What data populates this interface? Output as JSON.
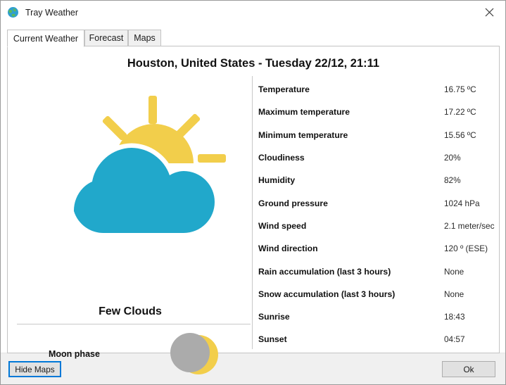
{
  "window": {
    "title": "Tray Weather",
    "app_icon": "globe-icon",
    "close_icon": "close-icon"
  },
  "tabs": [
    {
      "label": "Current Weather",
      "active": true
    },
    {
      "label": "Forecast",
      "active": false
    },
    {
      "label": "Maps",
      "active": false
    }
  ],
  "header": {
    "title": "Houston, United States - Tuesday 22/12, 21:11"
  },
  "current": {
    "icon": "few-clouds-icon",
    "condition": "Few Clouds",
    "moon_label": "Moon phase",
    "moon_icon": "waning-crescent-moon-icon"
  },
  "details": [
    {
      "label": "Temperature",
      "value": "16.75 ºC"
    },
    {
      "label": "Maximum temperature",
      "value": "17.22 ºC"
    },
    {
      "label": "Minimum temperature",
      "value": "15.56 ºC"
    },
    {
      "label": "Cloudiness",
      "value": "20%"
    },
    {
      "label": "Humidity",
      "value": "82%"
    },
    {
      "label": "Ground pressure",
      "value": "1024 hPa"
    },
    {
      "label": "Wind speed",
      "value": "2.1 meter/sec"
    },
    {
      "label": "Wind direction",
      "value": "120 º (ESE)"
    },
    {
      "label": "Rain accumulation (last 3 hours)",
      "value": "None"
    },
    {
      "label": "Snow accumulation (last 3 hours)",
      "value": "None"
    },
    {
      "label": "Sunrise",
      "value": "18:43"
    },
    {
      "label": "Sunset",
      "value": "04:57"
    }
  ],
  "footer": {
    "hide_maps_label": "Hide Maps",
    "ok_label": "Ok"
  },
  "colors": {
    "cloud_blue": "#21a8cb",
    "sun_yellow": "#f2ce4b",
    "moon_gray": "#ababab",
    "focus_blue": "#0078d7"
  }
}
